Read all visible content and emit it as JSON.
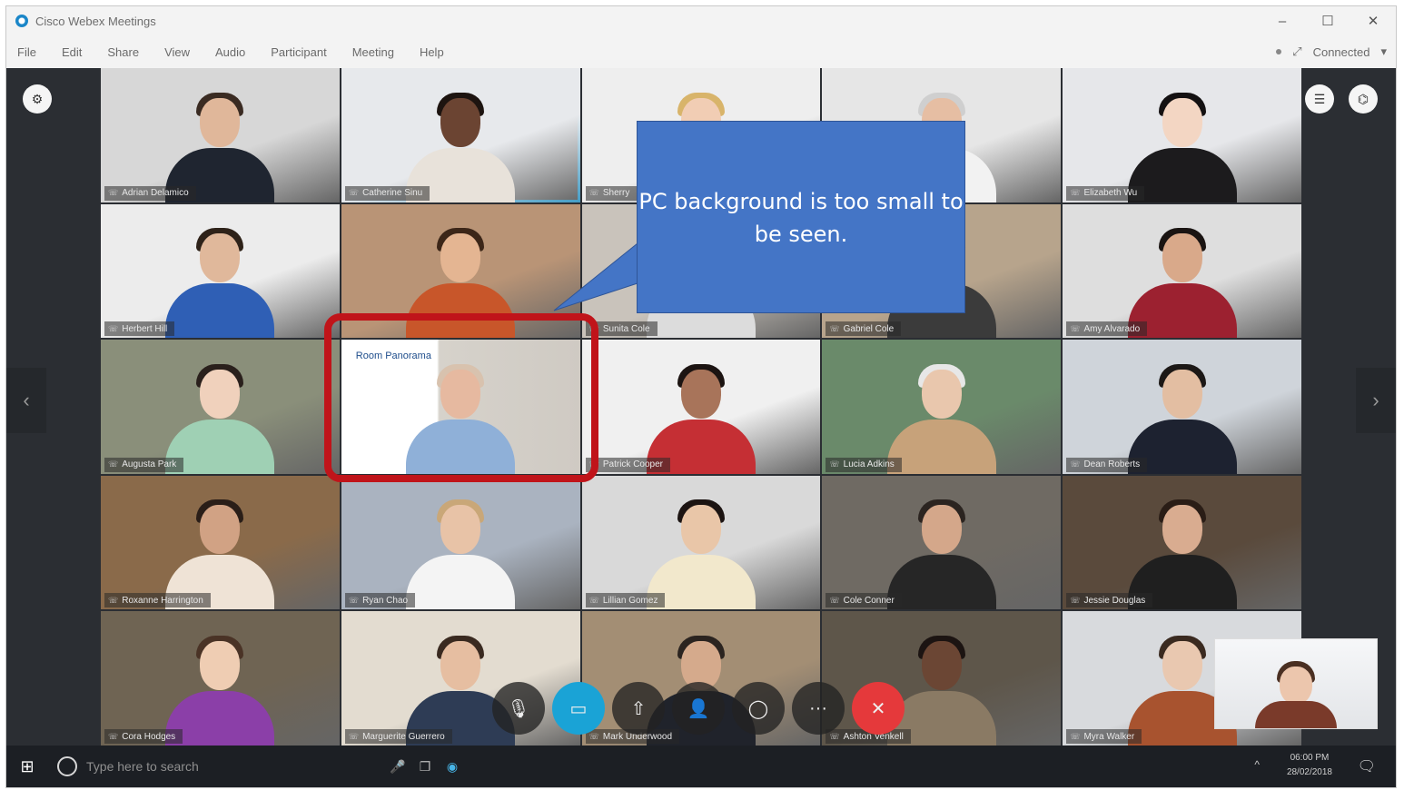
{
  "window": {
    "title": "Cisco Webex Meetings",
    "controls": [
      "–",
      "☐",
      "✕"
    ]
  },
  "menu": {
    "items": [
      "File",
      "Edit",
      "Share",
      "View",
      "Audio",
      "Participant",
      "Meeting",
      "Help"
    ],
    "status": "Connected"
  },
  "participants": [
    {
      "name": "Adrian Delamico",
      "skin": "#e0b79a",
      "hair": "#3a2b22",
      "shirt": "#1f2530",
      "bg": "#d7d7d7"
    },
    {
      "name": "Catherine Sinu",
      "skin": "#6b4432",
      "hair": "#1d1410",
      "shirt": "#e8e2da",
      "bg": "#e7e9ec",
      "active": true
    },
    {
      "name": "Sherry",
      "skin": "#f1cdb4",
      "hair": "#d8b46a",
      "shirt": "#e9e9e9",
      "bg": "#eeeeee"
    },
    {
      "name": "",
      "skin": "#e6bea3",
      "hair": "#cfcfcf",
      "shirt": "#f2f2f2",
      "bg": "#e6e6e6"
    },
    {
      "name": "Elizabeth Wu",
      "skin": "#f3d6c3",
      "hair": "#141112",
      "shirt": "#1c1b1d",
      "bg": "#e6e7ea"
    },
    {
      "name": "Herbert Hill",
      "skin": "#e0b89b",
      "hair": "#2e2219",
      "shirt": "#2f5fb5",
      "bg": "#ececec"
    },
    {
      "name": "",
      "skin": "#e4b592",
      "hair": "#3c2618",
      "shirt": "#c8562a",
      "bg": "#b99476"
    },
    {
      "name": "Sunita Cole",
      "skin": "#e6c1a8",
      "hair": "#3b2b21",
      "shirt": "#dcdcdc",
      "bg": "#c9c3bb"
    },
    {
      "name": "Gabriel Cole",
      "skin": "#c98f6d",
      "hair": "#1e1612",
      "shirt": "#3b3b3b",
      "bg": "#b7a48c"
    },
    {
      "name": "Amy Alvarado",
      "skin": "#d9a98a",
      "hair": "#1a1412",
      "shirt": "#9c2130",
      "bg": "#dedede"
    },
    {
      "name": "Augusta Park",
      "skin": "#f0d1bc",
      "hair": "#2a201c",
      "shirt": "#9fd0b4",
      "bg": "#8a8f7a"
    },
    {
      "name": "",
      "skin": "#e6b9a0",
      "hair": "#d8c2ae",
      "shirt": "#8fb0d8",
      "bg": "#e7e7e7",
      "slide": true
    },
    {
      "name": "Patrick Cooper",
      "skin": "#a8745a",
      "hair": "#1c1412",
      "shirt": "#c52f34",
      "bg": "#f0f0f0"
    },
    {
      "name": "Lucia Adkins",
      "skin": "#e9c7ad",
      "hair": "#e7e7e7",
      "shirt": "#c7a27a",
      "bg": "#6a8a6a"
    },
    {
      "name": "Dean Roberts",
      "skin": "#e3bea2",
      "hair": "#1c1816",
      "shirt": "#1d2230",
      "bg": "#cfd4da"
    },
    {
      "name": "Roxanne Harrington",
      "skin": "#d1a284",
      "hair": "#2a1e18",
      "shirt": "#efe3d6",
      "bg": "#8a6a4a"
    },
    {
      "name": "Ryan Chao",
      "skin": "#e8c3a7",
      "hair": "#c9a778",
      "shirt": "#f4f4f4",
      "bg": "#aab3c0"
    },
    {
      "name": "Lillian Gomez",
      "skin": "#e9c6a8",
      "hair": "#1c1412",
      "shirt": "#f2e8cc",
      "bg": "#d9d9d9"
    },
    {
      "name": "Cole Conner",
      "skin": "#d4a78a",
      "hair": "#2b2420",
      "shirt": "#262626",
      "bg": "#6f6a63"
    },
    {
      "name": "Jessie Douglas",
      "skin": "#d9ac90",
      "hair": "#2a1d16",
      "shirt": "#1f1f1f",
      "bg": "#5a4a3c"
    },
    {
      "name": "Cora Hodges",
      "skin": "#efcdb3",
      "hair": "#4a3326",
      "shirt": "#8b3fa8",
      "bg": "#6f6453"
    },
    {
      "name": "Marguerite Guerrero",
      "skin": "#e6bea1",
      "hair": "#3a2a20",
      "shirt": "#2e3c55",
      "bg": "#e3dcd0"
    },
    {
      "name": "Mark Underwood",
      "skin": "#d5aa8c",
      "hair": "#2b2420",
      "shirt": "#20232b",
      "bg": "#a38e74"
    },
    {
      "name": "Ashton Venkell",
      "skin": "#6b4634",
      "hair": "#1c1412",
      "shirt": "#8a7a64",
      "bg": "#5e564a"
    },
    {
      "name": "Myra Walker",
      "skin": "#e9c8b0",
      "hair": "#3a2a20",
      "shirt": "#a8532f",
      "bg": "#d8dadd"
    }
  ],
  "slide": {
    "title": "Room Panorama"
  },
  "toolbar": [
    {
      "id": "mute",
      "glyph": "🎙"
    },
    {
      "id": "video",
      "glyph": "▭"
    },
    {
      "id": "share",
      "glyph": "⇧"
    },
    {
      "id": "participants",
      "glyph": "👤"
    },
    {
      "id": "chat",
      "glyph": "◯"
    },
    {
      "id": "more",
      "glyph": "···"
    },
    {
      "id": "end",
      "glyph": "✕"
    }
  ],
  "taskbar": {
    "search_placeholder": "Type here to search",
    "time": "06:00 PM",
    "date": "28/02/2018"
  },
  "callout": {
    "text": "PC background is too small to be seen."
  },
  "colors": {
    "callout": "#4475c6",
    "highlight": "#c0141a",
    "video_button": "#1aa3d6",
    "end_button": "#e5393b"
  }
}
